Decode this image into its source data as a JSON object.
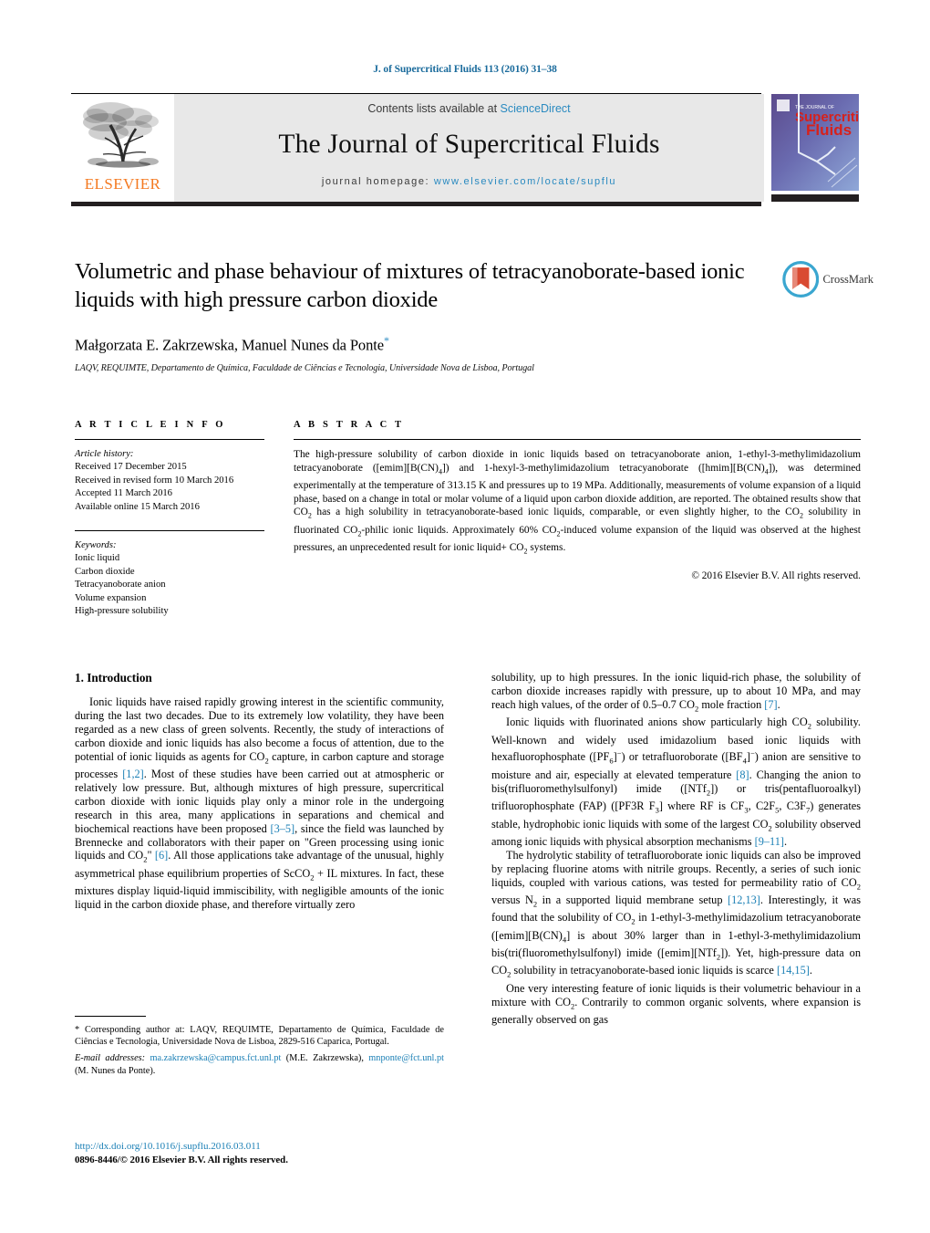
{
  "running_head": "J. of Supercritical Fluids 113 (2016) 31–38",
  "masthead": {
    "contents_prefix": "Contents lists available at ",
    "sciencedirect": "ScienceDirect",
    "journal_title": "The Journal of Supercritical Fluids",
    "homepage_prefix": "journal homepage: ",
    "homepage_url": "www.elsevier.com/locate/supflu",
    "publisher": "ELSEVIER",
    "publisher_color": "#f47920",
    "link_color": "#2a8ac0",
    "cover": {
      "line1": "THE JOURNAL OF",
      "line2": "Supercritical",
      "line3": "Fluids"
    }
  },
  "article": {
    "title": "Volumetric and phase behaviour of mixtures of tetracyanoborate-based ionic liquids with high pressure carbon dioxide",
    "authors": "Małgorzata E. Zakrzewska, Manuel Nunes da Ponte",
    "corresponding_mark": "*",
    "affiliation": "LAQV, REQUIMTE, Departamento de Química, Faculdade de Ciências e Tecnologia, Universidade Nova de Lisboa, Portugal",
    "crossmark_label": "CrossMark"
  },
  "article_info": {
    "heading": "A R T I C L E   I N F O",
    "history_label": "Article history:",
    "history": [
      "Received 17 December 2015",
      "Received in revised form 10 March 2016",
      "Accepted 11 March 2016",
      "Available online 15 March 2016"
    ],
    "keywords_label": "Keywords:",
    "keywords": [
      "Ionic liquid",
      "Carbon dioxide",
      "Tetracyanoborate anion",
      "Volume expansion",
      "High-pressure solubility"
    ]
  },
  "abstract": {
    "heading": "A B S T R A C T",
    "paragraphs": [
      "The high-pressure solubility of carbon dioxide in ionic liquids based on tetracyanoborate anion, 1-ethyl-3-methylimidazolium tetracyanoborate ([emim][B(CN)4]) and 1-hexyl-3-methylimidazolium tetracyanoborate ([hmim][B(CN)4]), was determined experimentally at the temperature of 313.15 K and pressures up to 19 MPa. Additionally, measurements of volume expansion of a liquid phase, based on a change in total or molar volume of a liquid upon carbon dioxide addition, are reported. The obtained results show that CO2 has a high solubility in tetracyanoborate-based ionic liquids, comparable, or even slightly higher, to the CO2 solubility in fluorinated CO2-philic ionic liquids. Approximately 60% CO2-induced volume expansion of the liquid was observed at the highest pressures, an unprecedented result for ionic liquid+ CO2 systems."
    ],
    "copyright": "© 2016 Elsevier B.V. All rights reserved."
  },
  "body": {
    "section_number_title": "1.  Introduction",
    "left_paragraphs": [
      "Ionic liquids have raised rapidly growing interest in the scientific community, during the last two decades. Due to its extremely low volatility, they have been regarded as a new class of green solvents. Recently, the study of interactions of carbon dioxide and ionic liquids has also become a focus of attention, due to the potential of ionic liquids as agents for CO2 capture, in carbon capture and storage processes [1,2]. Most of these studies have been carried out at atmospheric or relatively low pressure. But, although mixtures of high pressure, supercritical carbon dioxide with ionic liquids play only a minor role in the undergoing research in this area, many applications in separations and chemical and biochemical reactions have been proposed [3–5], since the field was launched by Brennecke and collaborators with their paper on \"Green processing using ionic liquids and CO2\" [6]. All those applications take advantage of the unusual, highly asymmetrical phase equilibrium properties of ScCO2 + IL mixtures. In fact, these mixtures display liquid-liquid immiscibility, with negligible amounts of the ionic liquid in the carbon dioxide phase, and therefore virtually zero"
    ],
    "right_paragraphs": [
      "solubility, up to high pressures. In the ionic liquid-rich phase, the solubility of carbon dioxide increases rapidly with pressure, up to about 10 MPa, and may reach high values, of the order of 0.5–0.7 CO2 mole fraction [7].",
      "Ionic liquids with fluorinated anions show particularly high CO2 solubility. Well-known and widely used imidazolium based ionic liquids with hexafluorophosphate ([PF6]−) or tetrafluoroborate ([BF4]−) anion are sensitive to moisture and air, especially at elevated temperature [8]. Changing the anion to bis(trifluoromethylsulfonyl) imide ([NTf2]) or tris(pentafluoroalkyl) trifluorophosphate (FAP) ([PF3R F3] where RF is CF3, C2F5, C3F7) generates stable, hydrophobic ionic liquids with some of the largest CO2 solubility observed among ionic liquids with physical absorption mechanisms [9–11].",
      "The hydrolytic stability of tetrafluoroborate ionic liquids can also be improved by replacing fluorine atoms with nitrile groups. Recently, a series of such ionic liquids, coupled with various cations, was tested for permeability ratio of CO2 versus N2 in a supported liquid membrane setup [12,13]. Interestingly, it was found that the solubility of CO2 in 1-ethyl-3-methylimidazolium tetracyanoborate ([emim][B(CN)4] is about 30% larger than in 1-ethyl-3-methylimidazolium bis(tri(fluoromethylsulfonyl) imide ([emim][NTf2]). Yet, high-pressure data on CO2 solubility in tetracyanoborate-based ionic liquids is scarce [14,15].",
      "One very interesting feature of ionic liquids is their volumetric behaviour in a mixture with CO2. Contrarily to common organic solvents, where expansion is generally observed on gas"
    ]
  },
  "footnotes": {
    "corresponding": "* Corresponding author at: LAQV, REQUIMTE, Departamento de Química, Faculdade de Ciências e Tecnologia, Universidade Nova de Lisboa, 2829-516 Caparica, Portugal.",
    "email_label": "E-mail addresses:",
    "email_1": "ma.zakrzewska@campus.fct.unl.pt",
    "email_1_owner": "(M.E. Zakrzewska),",
    "email_2": "mnponte@fct.unl.pt",
    "email_2_owner": "(M. Nunes da Ponte).",
    "doi": "http://dx.doi.org/10.1016/j.supflu.2016.03.011",
    "issn_line": "0896-8446/© 2016 Elsevier B.V. All rights reserved."
  }
}
